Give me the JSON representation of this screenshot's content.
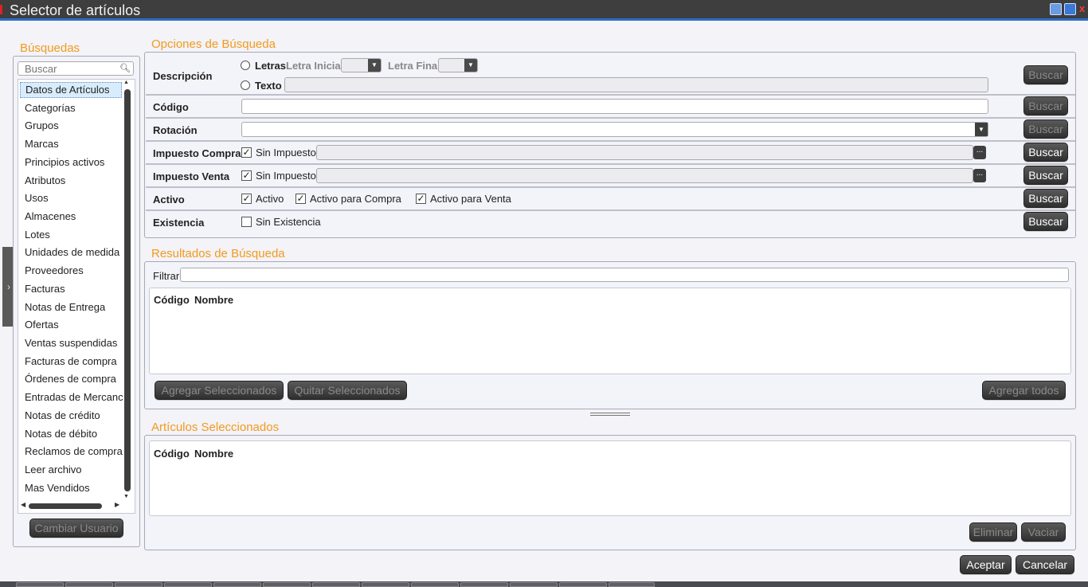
{
  "window": {
    "title": "Selector de artículos",
    "close_glyph": "x",
    "accent_color": "#2c6dc8",
    "label_color": "#f39a1c"
  },
  "sidebar": {
    "heading": "Búsquedas",
    "search_placeholder": "Buscar",
    "items": [
      "Datos de Artículos",
      "Categorías",
      "Grupos",
      "Marcas",
      "Principios activos",
      "Atributos",
      "Usos",
      "Almacenes",
      "Lotes",
      "Unidades de medida",
      "Proveedores",
      "Facturas",
      "Notas de Entrega",
      "Ofertas",
      "Ventas suspendidas",
      "Facturas de compra",
      "Órdenes de compra",
      "Entradas de Mercancía",
      "Notas de crédito",
      "Notas de débito",
      "Reclamos de compra",
      "Leer archivo",
      "Mas Vendidos"
    ],
    "selected_index": 0,
    "change_user_label": "Cambiar Usuario"
  },
  "options": {
    "heading": "Opciones de Búsqueda",
    "search_label": "Buscar",
    "descripcion": {
      "label": "Descripción",
      "letras_label": "Letras",
      "letra_inicial_label": "Letra Inicial",
      "letra_final_label": "Letra Final",
      "texto_label": "Texto"
    },
    "codigo": {
      "label": "Código"
    },
    "rotacion": {
      "label": "Rotación"
    },
    "impuesto_compra": {
      "label": "Impuesto Compra",
      "check_label": "Sin Impuesto",
      "checked": true,
      "ellipsis": "..."
    },
    "impuesto_venta": {
      "label": "Impuesto Venta",
      "check_label": "Sin Impuesto",
      "checked": true,
      "ellipsis": "..."
    },
    "activo": {
      "label": "Activo",
      "checks": [
        {
          "label": "Activo",
          "checked": true
        },
        {
          "label": "Activo para Compra",
          "checked": true
        },
        {
          "label": "Activo para Venta",
          "checked": true
        }
      ]
    },
    "existencia": {
      "label": "Existencia",
      "check_label": "Sin Existencia",
      "checked": false
    }
  },
  "results": {
    "heading": "Resultados de Búsqueda",
    "filter_label": "Filtrar",
    "columns": [
      "Código",
      "Nombre"
    ],
    "add_selected_label": "Agregar Seleccionados",
    "remove_selected_label": "Quitar Seleccionados",
    "add_all_label": "Agregar todos"
  },
  "selected": {
    "heading": "Artículos Seleccionados",
    "columns": [
      "Código",
      "Nombre"
    ],
    "delete_label": "Eliminar",
    "clear_label": "Vaciar"
  },
  "footer": {
    "accept_label": "Aceptar",
    "cancel_label": "Cancelar"
  }
}
